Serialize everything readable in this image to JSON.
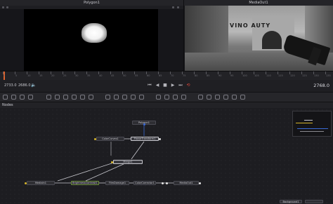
{
  "viewers": {
    "left_title": "Polygon1",
    "right_title": "MediaOut1",
    "scene_wall_text": "VINO AUTY"
  },
  "ruler": {
    "labels": [
      "0",
      "5",
      "10",
      "15",
      "20",
      "25",
      "30",
      "35",
      "40",
      "45",
      "50",
      "55",
      "60",
      "65",
      "70",
      "75",
      "80",
      "85",
      "90",
      "95",
      "100",
      "105",
      "110",
      "115",
      "120",
      "125",
      "130",
      "135"
    ]
  },
  "transport": {
    "start_frame": "2733.0",
    "current_frame": "2686.0",
    "end_frame": "2768.0",
    "buttons": {
      "first": "⏮",
      "prev": "◀",
      "stop": "■",
      "play": "▶",
      "last": "⏭",
      "loop": "⟲"
    }
  },
  "nodes_panel": {
    "title": "Nodes",
    "nodes": {
      "polygon": "Polygon1",
      "colorcurves": "ColorCurves1",
      "planar": "PlanarTransform1",
      "merge": "Merge1",
      "mediain": "MediaIn1",
      "brightness": "BrightnessContrast1",
      "filmdamage": "FilmDamage1",
      "colorcorrector": "ColorCorrector1",
      "mediaout": "MediaOut1",
      "background": "Background1"
    }
  },
  "colors": {
    "accent_orange": "#e0622b",
    "loop_red": "#e0473a",
    "input_yellow": "#d6b52a",
    "output_white": "#e6e6e6",
    "mask_blue": "#3a6ad6"
  }
}
